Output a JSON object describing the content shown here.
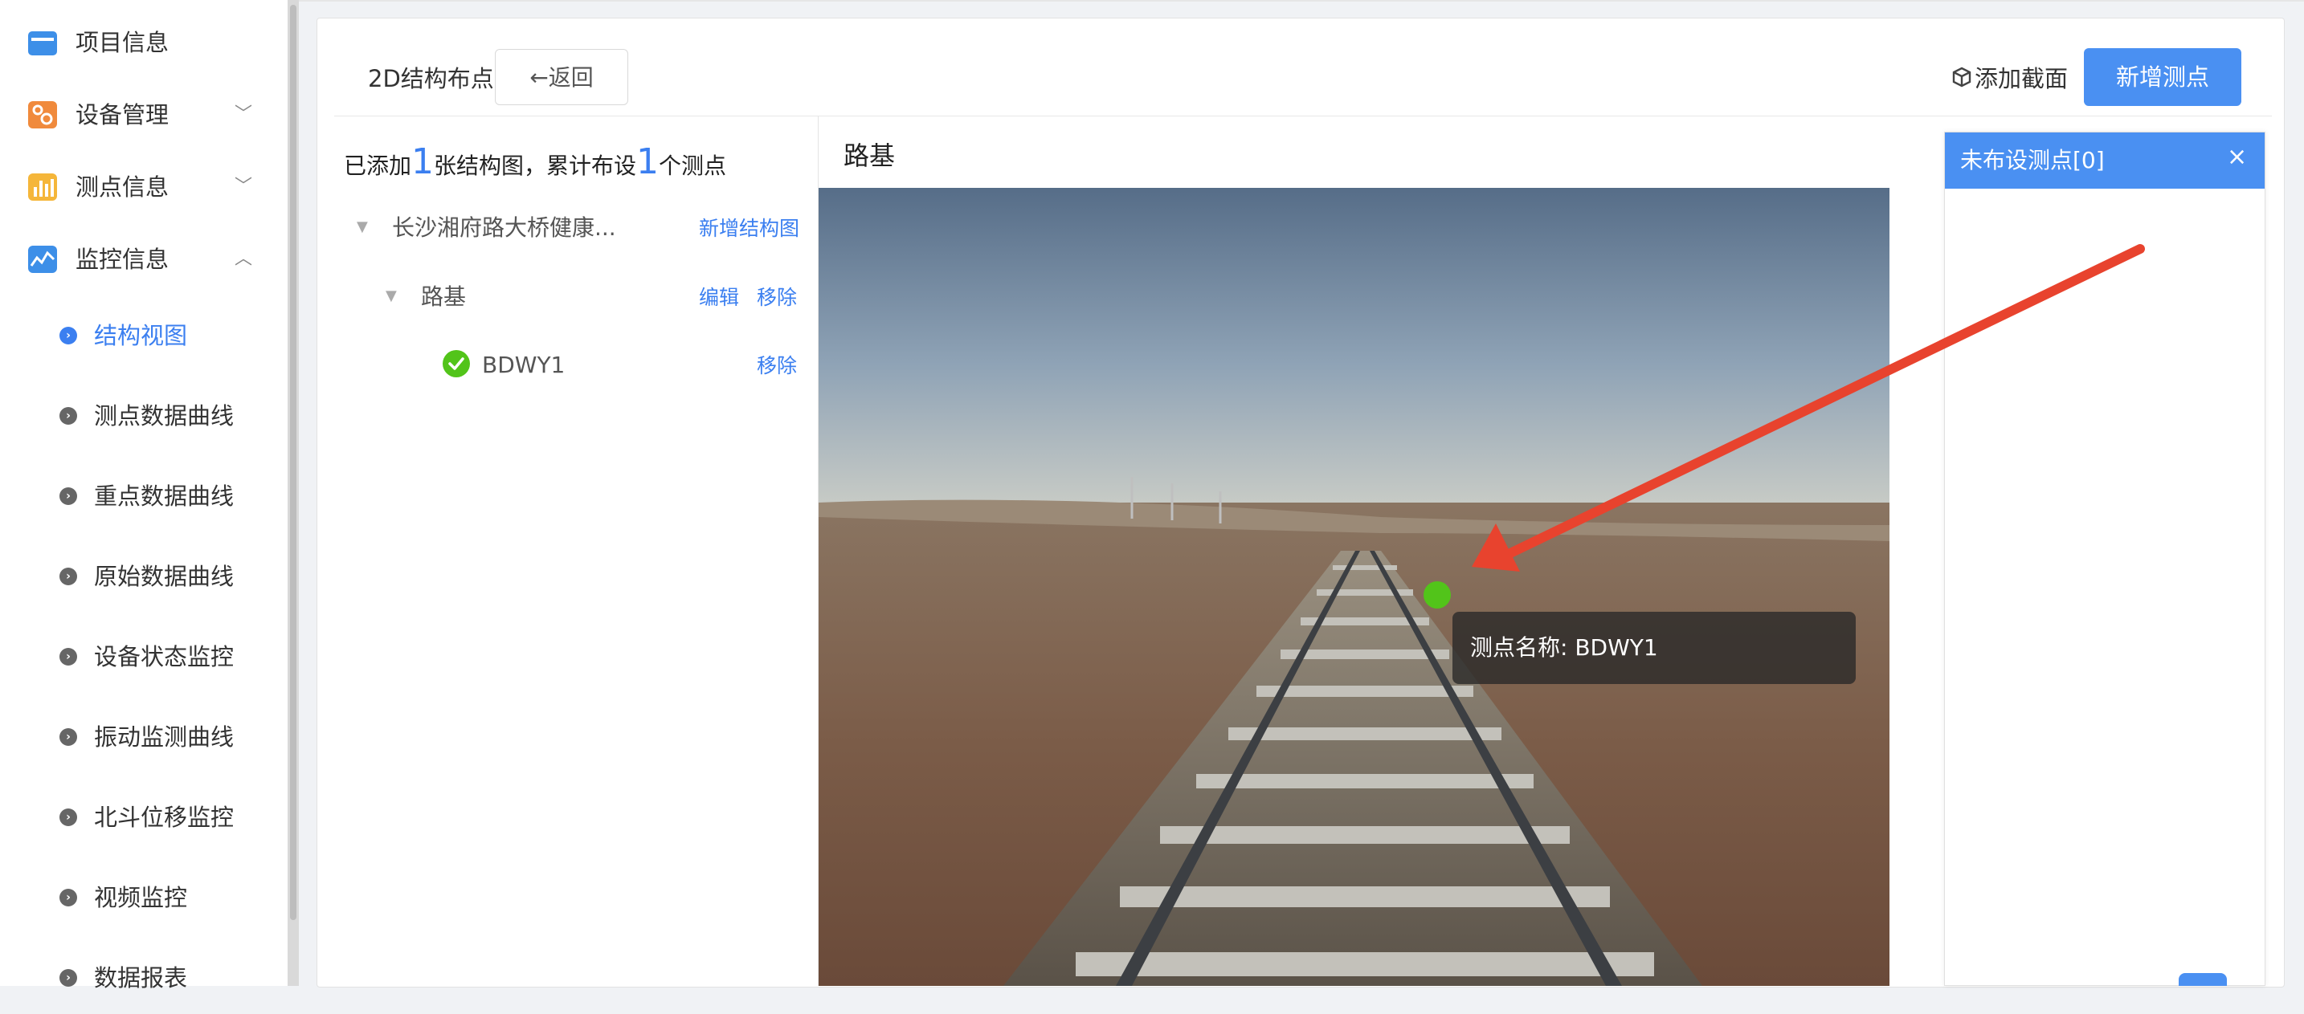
{
  "sidebar": {
    "menus": [
      {
        "label": "项目信息",
        "icon": "folder-icon",
        "chevron": ""
      },
      {
        "label": "设备管理",
        "icon": "device-settings-icon",
        "chevron": "﹀"
      },
      {
        "label": "测点信息",
        "icon": "bar-chart-icon",
        "chevron": "﹀"
      },
      {
        "label": "监控信息",
        "icon": "line-chart-icon",
        "chevron": "︿"
      }
    ],
    "sub_items": [
      {
        "label": "结构视图",
        "active": true
      },
      {
        "label": "测点数据曲线"
      },
      {
        "label": "重点数据曲线"
      },
      {
        "label": "原始数据曲线"
      },
      {
        "label": "设备状态监控"
      },
      {
        "label": "振动监测曲线"
      },
      {
        "label": "北斗位移监控"
      },
      {
        "label": "视频监控"
      },
      {
        "label": "数据报表"
      }
    ]
  },
  "toolbar": {
    "page_label": "2D结构布点",
    "back_label": "←返回",
    "add_section_label": "添加截面",
    "add_point_label": "新增测点"
  },
  "summary": {
    "prefix": "已添加",
    "structure_count": "1",
    "middle": "张结构图，累计布设",
    "point_count": "1",
    "suffix": "个测点"
  },
  "tree": {
    "root_label": "长沙湘府路大桥健康...",
    "root_action": "新增结构图",
    "section_label": "路基",
    "section_edit": "编辑",
    "section_remove": "移除",
    "point_label": "BDWY1",
    "point_remove": "移除"
  },
  "image_panel": {
    "title": "路基",
    "tooltip": "测点名称: BDWY1"
  },
  "unassigned": {
    "title": "未布设测点[0]",
    "close": "×"
  },
  "colors": {
    "accent": "#4a90f2",
    "link": "#3b7ff0",
    "marker": "#52c41a",
    "arrow": "#e8432e"
  }
}
